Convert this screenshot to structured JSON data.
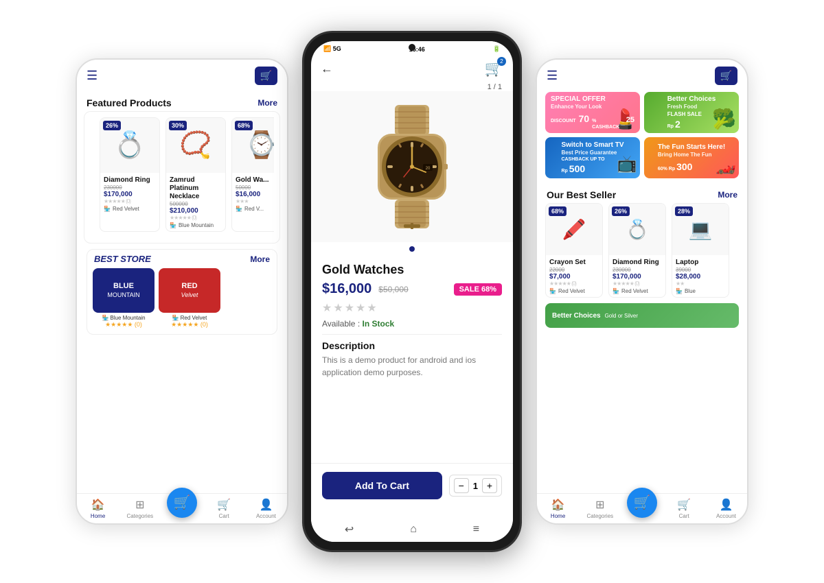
{
  "phone_left": {
    "header": {
      "menu_icon": "☰",
      "cart_icon": "🛒"
    },
    "featured": {
      "title": "Featured Products",
      "more": "More",
      "products": [
        {
          "name": "Diamond Ring",
          "old_price": "230000",
          "price": "$170,000",
          "discount": "26%",
          "rating": 0,
          "store": "Red Velvet",
          "emoji": "💍"
        },
        {
          "name": "Zamrud Platinum Necklace",
          "old_price": "500000",
          "price": "$210,000",
          "discount": "30%",
          "rating": 0,
          "store": "Blue Mountain",
          "emoji": "📿"
        },
        {
          "name": "Gold Wa...",
          "old_price": "50000",
          "price": "$16,000",
          "discount": "68%",
          "rating": 0,
          "store": "Red V...",
          "emoji": "⌚"
        }
      ]
    },
    "best_store": {
      "label": "BEST STORE",
      "more": "More",
      "stores": [
        {
          "name": "BLUE",
          "sub": "MOUNTAIN",
          "color": "blue",
          "rating": 0,
          "label": "Blue Mountain"
        },
        {
          "name": "RED",
          "sub": "Velvet",
          "color": "red",
          "rating": 0,
          "label": "Red Velvet"
        }
      ]
    },
    "nav": {
      "items": [
        "Home",
        "Categories",
        "",
        "Cart",
        "Account"
      ],
      "icons": [
        "🏠",
        "⊞",
        "🛒",
        "🛒",
        "👤"
      ]
    }
  },
  "phone_middle": {
    "status_bar": {
      "time": "15:46",
      "signal": "5G"
    },
    "product": {
      "name": "Gold Watches",
      "price": "$16,000",
      "old_price": "$50,000",
      "sale_label": "SALE 68%",
      "rating": 0,
      "availability_label": "Available :",
      "availability_status": "In Stock",
      "page_counter": "1 / 1",
      "description_title": "Description",
      "description": "This is a demo product for android and ios application demo purposes.",
      "cart_badge": "2"
    },
    "actions": {
      "add_to_cart": "Add To Cart",
      "quantity": 1
    },
    "android_nav": [
      "↩",
      "⌂",
      "≡"
    ]
  },
  "phone_right": {
    "header": {
      "menu_icon": "☰",
      "cart_icon": "🛒"
    },
    "banners": [
      {
        "title": "SPECIAL OFFER",
        "sub": "Enhance Your Look",
        "amount": "70",
        "cashback": "25",
        "color": "pink"
      },
      {
        "title": "Better Choices",
        "sub": "Fresh Food",
        "extra": "FLASH SALE",
        "amount": "2",
        "color": "green"
      },
      {
        "title": "Switch to Smart TV",
        "sub": "Best Price Guarantee",
        "extra": "CASHBACK",
        "amount": "500",
        "color": "blue"
      },
      {
        "title": "The Fun Starts Here!",
        "sub": "Bring Home The Fun",
        "amount": "300",
        "color": "orange"
      }
    ],
    "best_seller": {
      "title": "Our Best Seller",
      "more": "More",
      "products": [
        {
          "name": "Crayon Set",
          "old_price": "22000",
          "price": "$7,000",
          "discount": "68%",
          "store": "Red Velvet",
          "emoji": "🖍️"
        },
        {
          "name": "Diamond Ring",
          "old_price": "230000",
          "price": "$170,000",
          "discount": "26%",
          "store": "Red Velvet",
          "emoji": "💍"
        },
        {
          "name": "Laptop",
          "old_price": "39000",
          "price": "$28,000",
          "discount": "28%",
          "store": "Blue",
          "emoji": "💻"
        }
      ]
    },
    "nav": {
      "items": [
        "Home",
        "Categories",
        "",
        "Cart",
        "Account"
      ]
    }
  }
}
